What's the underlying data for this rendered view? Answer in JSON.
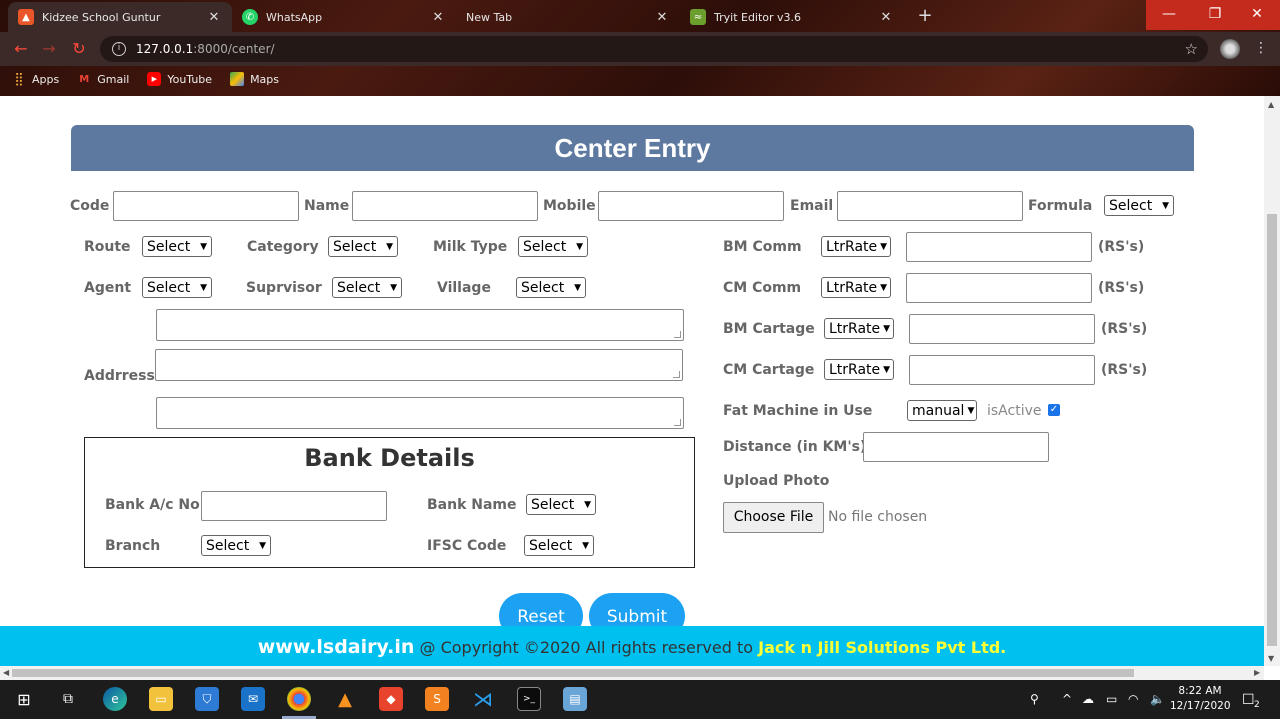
{
  "browser": {
    "tabs": [
      {
        "title": "Kidzee School Guntur",
        "icon": "kidzee-icon",
        "color": "#e8562a"
      },
      {
        "title": "WhatsApp",
        "icon": "whatsapp-icon",
        "color": "#25d366"
      },
      {
        "title": "New Tab",
        "icon": "",
        "color": ""
      },
      {
        "title": "Tryit Editor v3.6",
        "icon": "tryit-icon",
        "color": "#6b9e2d"
      }
    ],
    "url_host": "127.0.0.1",
    "url_path": ":8000/center/",
    "bookmarks": [
      {
        "label": "Apps",
        "icon": "apps-grid-icon"
      },
      {
        "label": "Gmail",
        "icon": "gmail-icon"
      },
      {
        "label": "YouTube",
        "icon": "youtube-icon"
      },
      {
        "label": "Maps",
        "icon": "maps-icon"
      }
    ]
  },
  "form": {
    "title": "Center Entry",
    "row1": {
      "code": "Code",
      "name": "Name",
      "mobile": "Mobile",
      "email": "Email",
      "formula": "Formula",
      "formula_value": "Select"
    },
    "left": {
      "route": "Route",
      "route_value": "Select",
      "category": "Category",
      "category_value": "Select",
      "milk_type": "Milk Type",
      "milk_type_value": "Select",
      "agent": "Agent",
      "agent_value": "Select",
      "supervisor": "Suprvisor",
      "supervisor_value": "Select",
      "village": "Village",
      "village_value": "Select",
      "address": "Addrress"
    },
    "right": {
      "bm_comm": "BM Comm",
      "bm_comm_value": "LtrRate",
      "cm_comm": "CM Comm",
      "cm_comm_value": "LtrRate",
      "bm_cartage": "BM Cartage",
      "bm_cartage_value": "LtrRate",
      "cm_cartage": "CM Cartage",
      "cm_cartage_value": "LtrRate",
      "rs": "(RS's)",
      "fat_machine": "Fat Machine in Use",
      "fat_machine_value": "manual",
      "is_active": "isActive",
      "is_active_checked": true,
      "distance": "Distance (in KM's)",
      "upload_photo": "Upload Photo",
      "choose_file": "Choose File",
      "no_file": "No file chosen"
    },
    "bank": {
      "title": "Bank Details",
      "account_no": "Bank A/c No",
      "bank_name": "Bank Name",
      "bank_name_value": "Select",
      "branch": "Branch",
      "branch_value": "Select",
      "ifsc": "IFSC Code",
      "ifsc_value": "Select"
    },
    "buttons": {
      "reset": "Reset",
      "submit": "Submit"
    }
  },
  "footer": {
    "site": "www.lsdairy.in",
    "text": " @ Copyright ©2020 All rights reserved to ",
    "company": "Jack n Jill Solutions Pvt Ltd."
  },
  "taskbar": {
    "time": "8:22 AM",
    "date": "12/17/2020",
    "notifications": "2"
  },
  "colors": {
    "header": "#5e79a0",
    "footer": "#00c0ef",
    "button": "#1da1f2",
    "company": "#ffff33"
  }
}
